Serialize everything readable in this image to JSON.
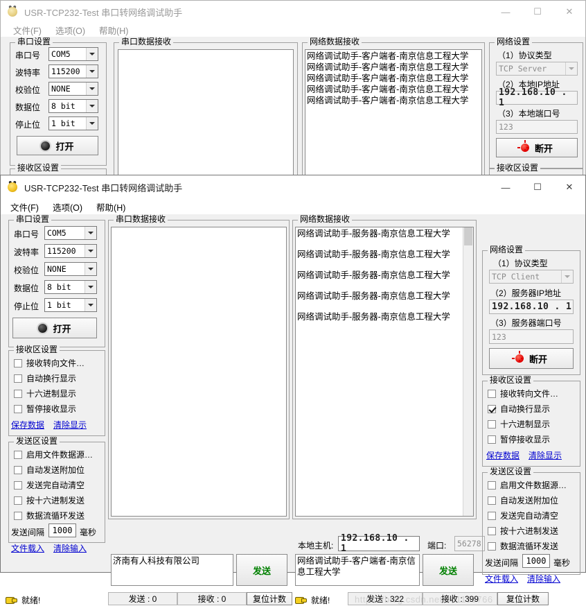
{
  "back_window": {
    "title": "USR-TCP232-Test 串口转网络调试助手",
    "menu": [
      "文件(F)",
      "选项(O)",
      "帮助(H)"
    ],
    "window_buttons": {
      "minimize": "—",
      "maximize": "☐",
      "close": "✕"
    },
    "serial_settings": {
      "caption": "串口设置",
      "rows": [
        {
          "label": "串口号",
          "value": "COM5"
        },
        {
          "label": "波特率",
          "value": "115200"
        },
        {
          "label": "校验位",
          "value": "NONE"
        },
        {
          "label": "数据位",
          "value": "8 bit"
        },
        {
          "label": "停止位",
          "value": "1 bit"
        }
      ],
      "button": "打开"
    },
    "serial_recv": {
      "caption": "串口数据接收",
      "lines": []
    },
    "net_recv": {
      "caption": "网络数据接收",
      "lines": [
        "网络调试助手-客户端者-南京信息工程大学",
        "网络调试助手-客户端者-南京信息工程大学",
        "网络调试助手-客户端者-南京信息工程大学",
        "网络调试助手-客户端者-南京信息工程大学",
        "网络调试助手-客户端者-南京信息工程大学"
      ]
    },
    "net_settings": {
      "caption": "网络设置",
      "protocol_label": "（1）协议类型",
      "protocol_value": "TCP Server",
      "ip_label": "（2）本地IP地址",
      "ip_value": "192.168.10 . 1",
      "port_label": "（3）本地端口号",
      "port_value": "123",
      "button": "断开"
    },
    "recv_settings_caption_left": "接收区设置",
    "recv_settings_caption_right": "接收区设置"
  },
  "front_window": {
    "title": "USR-TCP232-Test 串口转网络调试助手",
    "menu": [
      "文件(F)",
      "选项(O)",
      "帮助(H)"
    ],
    "window_buttons": {
      "minimize": "—",
      "maximize": "☐",
      "close": "✕"
    },
    "serial_settings": {
      "caption": "串口设置",
      "rows": [
        {
          "label": "串口号",
          "value": "COM5"
        },
        {
          "label": "波特率",
          "value": "115200"
        },
        {
          "label": "校验位",
          "value": "NONE"
        },
        {
          "label": "数据位",
          "value": "8 bit"
        },
        {
          "label": "停止位",
          "value": "1 bit"
        }
      ],
      "button": "打开"
    },
    "left_recv_settings": {
      "caption": "接收区设置",
      "checks": [
        {
          "label": "接收转向文件…",
          "checked": false
        },
        {
          "label": "自动换行显示",
          "checked": false
        },
        {
          "label": "十六进制显示",
          "checked": false
        },
        {
          "label": "暂停接收显示",
          "checked": false
        }
      ],
      "links": [
        "保存数据",
        "清除显示"
      ]
    },
    "left_send_settings": {
      "caption": "发送区设置",
      "checks": [
        {
          "label": "启用文件数据源…",
          "checked": false
        },
        {
          "label": "自动发送附加位",
          "checked": false
        },
        {
          "label": "发送完自动清空",
          "checked": false
        },
        {
          "label": "按十六进制发送",
          "checked": false
        },
        {
          "label": "数据流循环发送",
          "checked": false
        }
      ],
      "interval_label": "发送间隔",
      "interval_value": "1000",
      "interval_unit": "毫秒",
      "links": [
        "文件载入",
        "清除输入"
      ]
    },
    "serial_recv": {
      "caption": "串口数据接收",
      "lines": []
    },
    "serial_send": {
      "text": "济南有人科技有限公司",
      "button": "发送"
    },
    "net_recv": {
      "caption": "网络数据接收",
      "lines": [
        "网络调试助手-服务器-南京信息工程大学",
        "网络调试助手-服务器-南京信息工程大学",
        "网络调试助手-服务器-南京信息工程大学",
        "网络调试助手-服务器-南京信息工程大学",
        "网络调试助手-服务器-南京信息工程大学"
      ]
    },
    "net_host_row": {
      "host_label": "本地主机:",
      "host_value": "192.168.10 . 1",
      "port_label": "端口:",
      "port_value": "56278"
    },
    "net_send": {
      "text": "网络调试助手-客户端者-南京信息工程大学",
      "button": "发送"
    },
    "net_settings": {
      "caption": "网络设置",
      "protocol_label": "（1）协议类型",
      "protocol_value": "TCP Client",
      "ip_label": "（2）服务器IP地址",
      "ip_value": "192.168.10 . 1",
      "port_label": "（3）服务器端口号",
      "port_value": "123",
      "button": "断开"
    },
    "right_recv_settings": {
      "caption": "接收区设置",
      "checks": [
        {
          "label": "接收转向文件…",
          "checked": false
        },
        {
          "label": "自动换行显示",
          "checked": true
        },
        {
          "label": "十六进制显示",
          "checked": false
        },
        {
          "label": "暂停接收显示",
          "checked": false
        }
      ],
      "links": [
        "保存数据",
        "清除显示"
      ]
    },
    "right_send_settings": {
      "caption": "发送区设置",
      "checks": [
        {
          "label": "启用文件数据源…",
          "checked": false
        },
        {
          "label": "自动发送附加位",
          "checked": false
        },
        {
          "label": "发送完自动清空",
          "checked": false
        },
        {
          "label": "按十六进制发送",
          "checked": false
        },
        {
          "label": "数据流循环发送",
          "checked": false
        }
      ],
      "interval_label": "发送间隔",
      "interval_value": "1000",
      "interval_unit": "毫秒",
      "links": [
        "文件载入",
        "清除输入"
      ]
    },
    "status_left": {
      "ready": "就绪!",
      "sent": "发送 : 0",
      "recv": "接收 : 0",
      "reset": "复位计数"
    },
    "status_right": {
      "ready": "就绪!",
      "sent": "发送 : 322",
      "recv": "接收 : 399",
      "reset": "复位计数"
    }
  },
  "watermark": "https://blog.csdn.net/461159766"
}
